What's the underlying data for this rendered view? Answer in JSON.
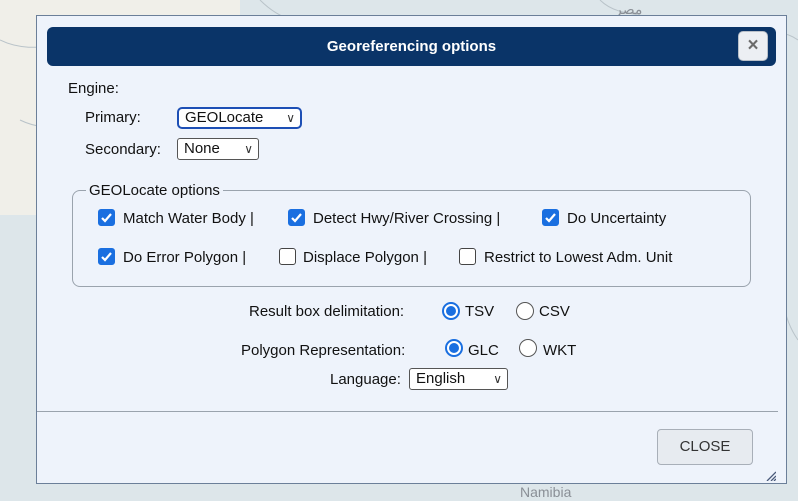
{
  "map": {
    "labels": [
      "مصر",
      "Namibia"
    ]
  },
  "dialog": {
    "title": "Georeferencing options",
    "close_icon": "×",
    "engine_label": "Engine:",
    "primary_label": "Primary:",
    "primary_value": "GEOLocate",
    "secondary_label": "Secondary:",
    "secondary_value": "None",
    "geolocate_legend": "GEOLocate options",
    "options": [
      {
        "label": "Match Water Body |",
        "checked": true
      },
      {
        "label": "Detect Hwy/River Crossing |",
        "checked": true
      },
      {
        "label": "Do Uncertainty",
        "checked": true
      },
      {
        "label": "Do Error Polygon |",
        "checked": true
      },
      {
        "label": "Displace Polygon |",
        "checked": false
      },
      {
        "label": "Restrict to Lowest Adm. Unit",
        "checked": false
      }
    ],
    "delimitation_label": "Result box delimitation:",
    "delimitation_options": [
      {
        "label": "TSV",
        "selected": true
      },
      {
        "label": "CSV",
        "selected": false
      }
    ],
    "polygon_label": "Polygon Representation:",
    "polygon_options": [
      {
        "label": "GLC",
        "selected": true
      },
      {
        "label": "WKT",
        "selected": false
      }
    ],
    "language_label": "Language:",
    "language_value": "English",
    "close_button": "CLOSE"
  },
  "colors": {
    "titlebar": "#0a3468",
    "accent": "#1a6fe0",
    "dialog_bg": "#eef3fb"
  },
  "icons": [
    "close-icon",
    "chevron-down-icon",
    "checkbox-checked-icon",
    "resize-grip-icon"
  ]
}
